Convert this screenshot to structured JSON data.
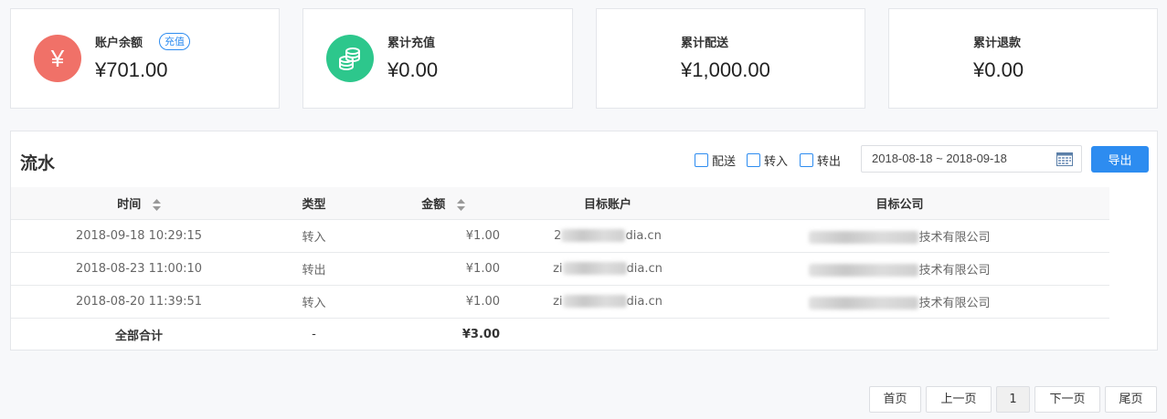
{
  "cards": [
    {
      "label": "账户余额",
      "value": "¥701.00",
      "icon": "yen-icon",
      "icon_color": "#f07168",
      "icon_glyph": "¥",
      "tag": "充值"
    },
    {
      "label": "累计充值",
      "value": "¥0.00",
      "icon": "coins-icon",
      "icon_color": "#2dc78c"
    },
    {
      "label": "累计配送",
      "value": "¥1,000.00"
    },
    {
      "label": "累计退款",
      "value": "¥0.00"
    }
  ],
  "ledger": {
    "title": "流水",
    "filters": [
      "配送",
      "转入",
      "转出"
    ],
    "date_range": "2018-08-18 ~ 2018-09-18",
    "export_label": "导出",
    "columns": [
      "时间",
      "类型",
      "金额",
      "目标账户",
      "目标公司"
    ],
    "rows": [
      {
        "time": "2018-09-18 10:29:15",
        "type": "转入",
        "amount": "¥1.00",
        "account_prefix": "2",
        "account_suffix": "dia.cn",
        "company_suffix": "技术有限公司"
      },
      {
        "time": "2018-08-23 11:00:10",
        "type": "转出",
        "amount": "¥1.00",
        "account_prefix": "zi",
        "account_suffix": "dia.cn",
        "company_suffix": "技术有限公司"
      },
      {
        "time": "2018-08-20 11:39:51",
        "type": "转入",
        "amount": "¥1.00",
        "account_prefix": "zi",
        "account_suffix": "dia.cn",
        "company_suffix": "技术有限公司"
      }
    ],
    "total": {
      "label": "全部合计",
      "type": "-",
      "amount": "¥3.00"
    }
  },
  "pagination": {
    "first": "首页",
    "prev": "上一页",
    "current": "1",
    "next": "下一页",
    "last": "尾页"
  },
  "colors": {
    "accent": "#2d8cf0"
  }
}
